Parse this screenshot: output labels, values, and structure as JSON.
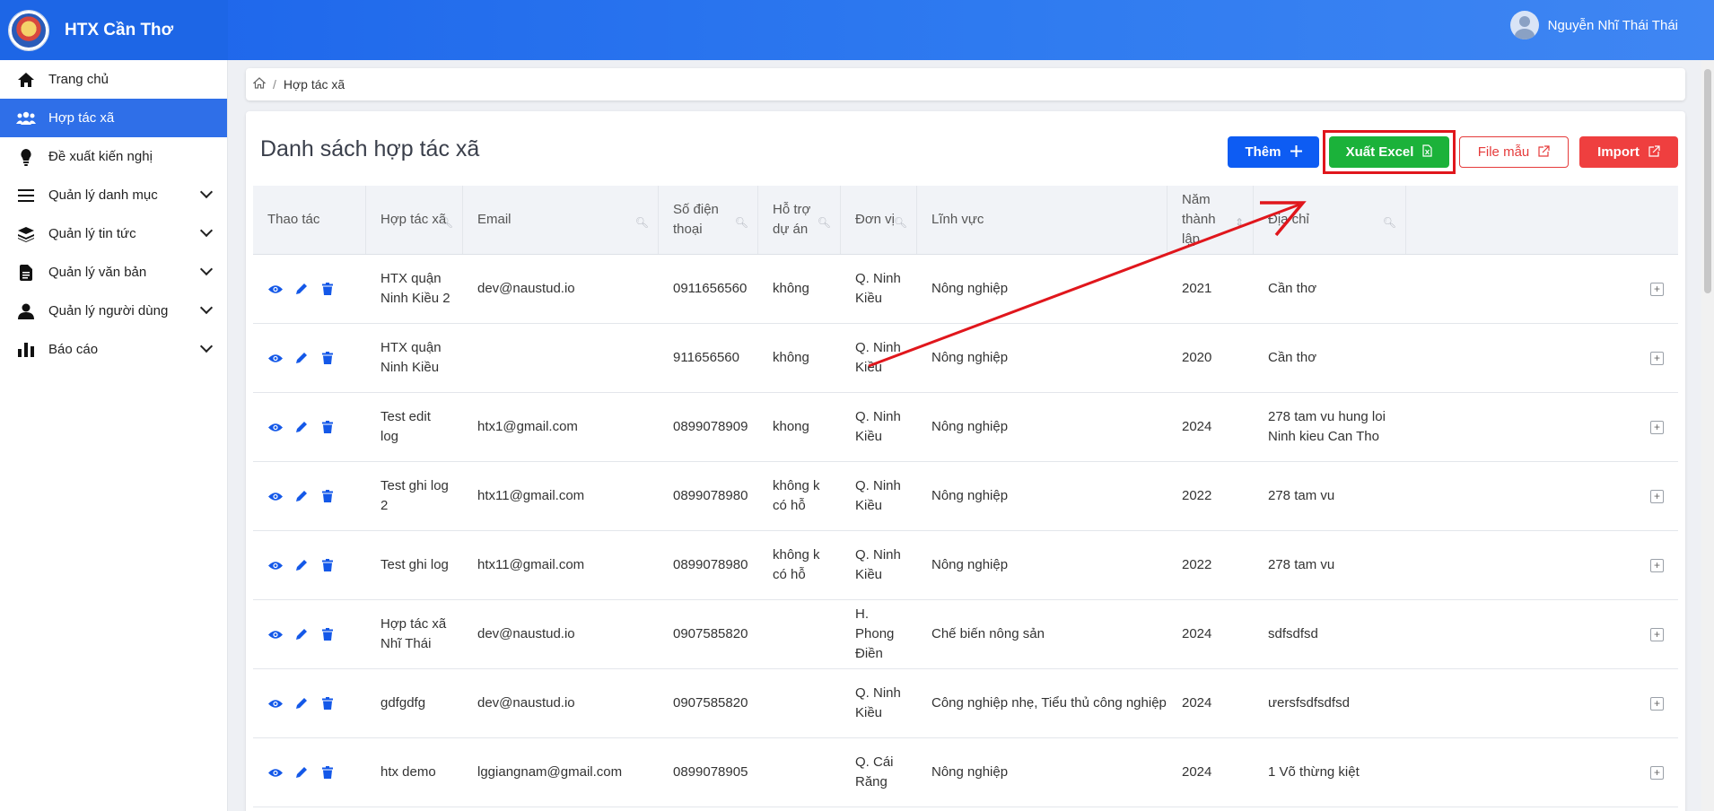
{
  "app": {
    "name": "HTX Cần Thơ"
  },
  "user": {
    "name": "Nguyễn Nhĩ Thái Thái"
  },
  "sidebar": {
    "items": [
      {
        "label": "Trang chủ",
        "icon": "home-icon",
        "active": false,
        "expandable": false
      },
      {
        "label": "Hợp tác xã",
        "icon": "users-icon",
        "active": true,
        "expandable": false
      },
      {
        "label": "Đề xuất kiến nghị",
        "icon": "lightbulb-icon",
        "active": false,
        "expandable": false
      },
      {
        "label": "Quản lý danh mục",
        "icon": "list-icon",
        "active": false,
        "expandable": true
      },
      {
        "label": "Quản lý tin tức",
        "icon": "layers-icon",
        "active": false,
        "expandable": true
      },
      {
        "label": "Quản lý văn bản",
        "icon": "document-icon",
        "active": false,
        "expandable": true
      },
      {
        "label": "Quản lý người dùng",
        "icon": "user-icon",
        "active": false,
        "expandable": true
      },
      {
        "label": "Báo cáo",
        "icon": "chart-icon",
        "active": false,
        "expandable": true
      }
    ]
  },
  "breadcrumb": {
    "current": "Hợp tác xã"
  },
  "page": {
    "title": "Danh sách hợp tác xã"
  },
  "toolbar": {
    "add_label": "Thêm",
    "export_label": "Xuất Excel",
    "template_label": "File mẫu",
    "import_label": "Import"
  },
  "table": {
    "headers": [
      "Thao tác",
      "Hợp tác xã",
      "Email",
      "Số điện thoại",
      "Hỗ trợ dự án",
      "Đơn vị",
      "Lĩnh vực",
      "Năm thành lập",
      "Địa chỉ"
    ],
    "rows": [
      {
        "name": "HTX quận Ninh Kiều 2",
        "email": "dev@naustud.io",
        "phone": "0911656560",
        "support": "không",
        "unit": "Q. Ninh Kiều",
        "field": "Nông nghiệp",
        "year": "2021",
        "address": "Cần thơ"
      },
      {
        "name": "HTX quận Ninh Kiều",
        "email": "",
        "phone": "911656560",
        "support": "không",
        "unit": "Q. Ninh Kiều",
        "field": "Nông nghiệp",
        "year": "2020",
        "address": "Cần thơ"
      },
      {
        "name": "Test edit log",
        "email": "htx1@gmail.com",
        "phone": "0899078909",
        "support": "khong",
        "unit": "Q. Ninh Kiều",
        "field": "Nông nghiệp",
        "year": "2024",
        "address": "278 tam vu hung loi Ninh kieu Can Tho"
      },
      {
        "name": "Test ghi log 2",
        "email": "htx11@gmail.com",
        "phone": "0899078980",
        "support": "không k có hỗ",
        "unit": "Q. Ninh Kiều",
        "field": "Nông nghiệp",
        "year": "2022",
        "address": "278 tam vu"
      },
      {
        "name": "Test ghi log",
        "email": "htx11@gmail.com",
        "phone": "0899078980",
        "support": "không k có hỗ",
        "unit": "Q. Ninh Kiều",
        "field": "Nông nghiệp",
        "year": "2022",
        "address": "278 tam vu"
      },
      {
        "name": "Hợp tác xã Nhĩ Thái",
        "email": "dev@naustud.io",
        "phone": "0907585820",
        "support": "",
        "unit": "H. Phong Điền",
        "field": "Chế biến nông sản",
        "year": "2024",
        "address": "sdfsdfsd"
      },
      {
        "name": "gdfgdfg",
        "email": "dev@naustud.io",
        "phone": "0907585820",
        "support": "",
        "unit": "Q. Ninh Kiều",
        "field": "Công nghiệp nhẹ, Tiểu thủ công nghiệp",
        "year": "2024",
        "address": "ưersfsdfsdfsd"
      },
      {
        "name": "htx demo",
        "email": "lggiangnam@gmail.com",
        "phone": "0899078905",
        "support": "",
        "unit": "Q. Cái Răng",
        "field": "Nông nghiệp",
        "year": "2024",
        "address": "1 Võ thừng kiệt"
      }
    ]
  },
  "colors": {
    "primary": "#0d5cf3",
    "export": "#1bb23a",
    "danger": "#ef3f3f",
    "annotation": "#e0161c"
  }
}
